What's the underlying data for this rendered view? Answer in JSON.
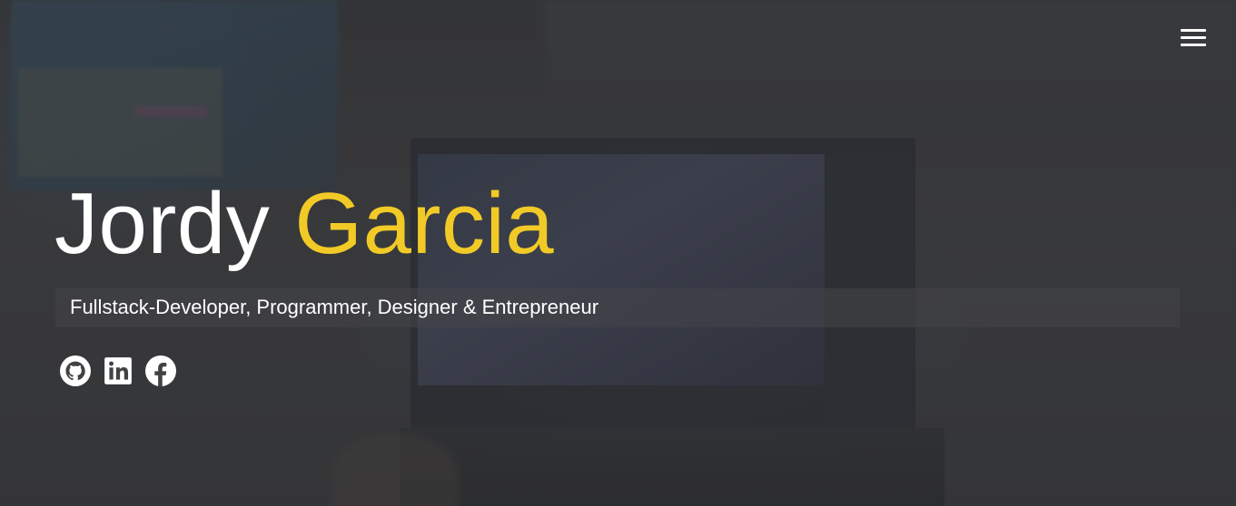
{
  "navigation": {
    "menu_icon": "hamburger-menu-icon"
  },
  "hero": {
    "first_name": "Jordy",
    "last_name": "Garcia",
    "tagline": "Fullstack-Developer, Programmer, Designer & Entrepreneur",
    "name_color": "#ffffff",
    "accent_color": "#f2ca27"
  },
  "socials": [
    {
      "icon": "github-icon"
    },
    {
      "icon": "linkedin-icon"
    },
    {
      "icon": "facebook-icon"
    }
  ]
}
